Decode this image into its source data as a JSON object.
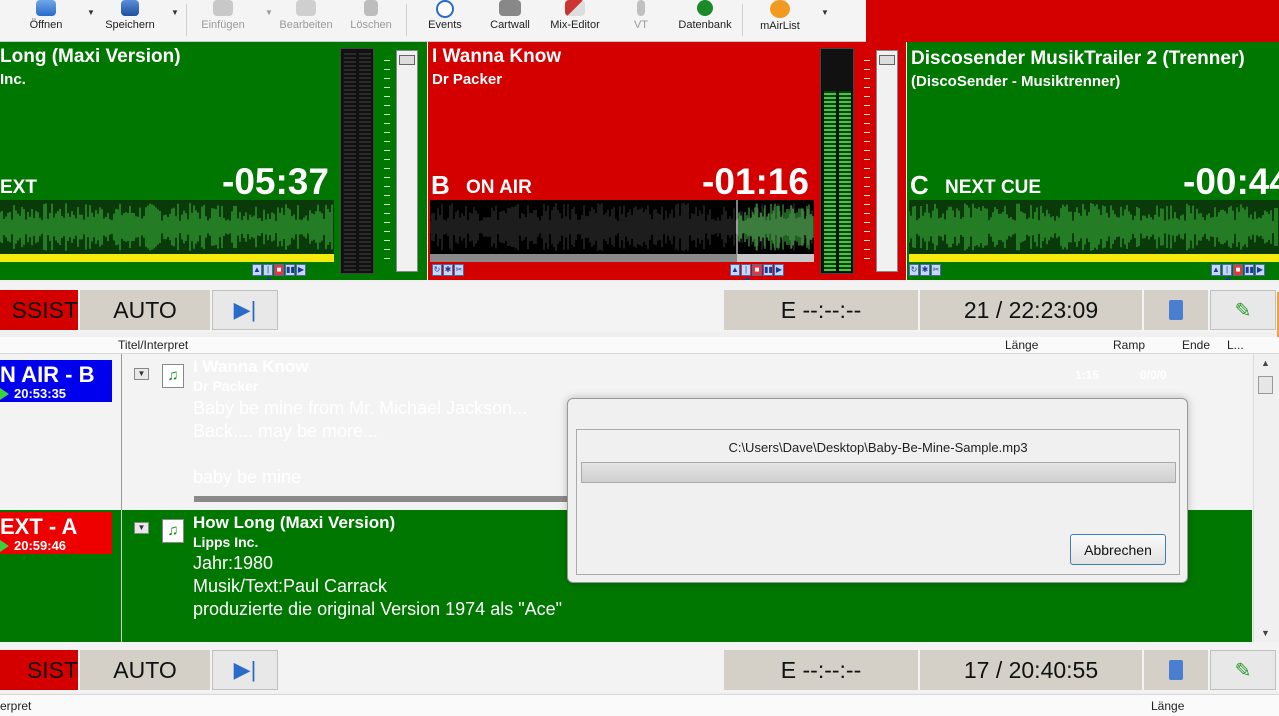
{
  "toolbar": {
    "items": [
      {
        "label": "Öffnen",
        "icon": "folder-open-icon"
      },
      {
        "label": "Speichern",
        "icon": "save-icon"
      },
      {
        "label": "Einfügen",
        "icon": "insert-icon"
      },
      {
        "label": "Bearbeiten",
        "icon": "edit-icon"
      },
      {
        "label": "Löschen",
        "icon": "trash-icon"
      },
      {
        "label": "Events",
        "icon": "clock-icon"
      },
      {
        "label": "Cartwall",
        "icon": "cartwall-icon"
      },
      {
        "label": "Mix-Editor",
        "icon": "mix-editor-icon"
      },
      {
        "label": "VT",
        "icon": "microphone-icon"
      },
      {
        "label": "Datenbank",
        "icon": "database-icon"
      },
      {
        "label": "mAirList",
        "icon": "mairlist-logo-icon"
      }
    ]
  },
  "players": {
    "a": {
      "title": "Long (Maxi Version)",
      "artist": "Inc.",
      "letter": "",
      "status": "EXT",
      "time": "-05:37",
      "bg": "#007700"
    },
    "b": {
      "title": "I Wanna Know",
      "artist": "Dr Packer",
      "letter": "B",
      "status": "ON AIR",
      "time": "-01:16",
      "bg": "#d40000",
      "progress": 0.8
    },
    "c": {
      "title": "Discosender MusikTrailer 2 (Trenner)",
      "artist": "(DiscoSender - Musiktrenner)",
      "letter": "C",
      "status": "NEXT CUE",
      "time": "-00:44",
      "bg": "#007700"
    }
  },
  "strip1": {
    "assist": "SSIST",
    "auto": "AUTO",
    "eta": "E  --:--:--",
    "count": "21 / 22:23:09"
  },
  "strip2": {
    "assist": "SIST",
    "auto": "AUTO",
    "eta": "E  --:--:--",
    "count": "17 / 20:40:55"
  },
  "playlist": {
    "headers": {
      "title": "Titel/Interpret",
      "length": "Länge",
      "ramp": "Ramp",
      "end": "Ende",
      "more": "L..."
    },
    "row1": {
      "tag": "N AIR - B",
      "tag_time": "20:53:35",
      "tag_color": "#0000ee",
      "title": "I Wanna Know",
      "artist": "Dr Packer",
      "line1": "Baby  be mine  from Mr. Michael Jackson...",
      "line2": "Back.... may be more...",
      "line3": "baby be mine",
      "length": "1:15",
      "ramp": "0/0/0"
    },
    "row2": {
      "tag": "EXT - A",
      "tag_time": "20:59:46",
      "tag_color": "#ee0000",
      "title": "How Long (Maxi Version)",
      "artist": "Lipps Inc.",
      "line1": "Jahr:1980",
      "line2": "Musik/Text:Paul Carrack",
      "line3": "produzierte die original Version 1974 als \"Ace\""
    }
  },
  "dialog": {
    "path": "C:\\Users\\Dave\\Desktop\\Baby-Be-Mine-Sample.mp3",
    "cancel": "Abbrechen"
  },
  "bottom_headers": {
    "title": "erpret",
    "length": "Länge"
  }
}
